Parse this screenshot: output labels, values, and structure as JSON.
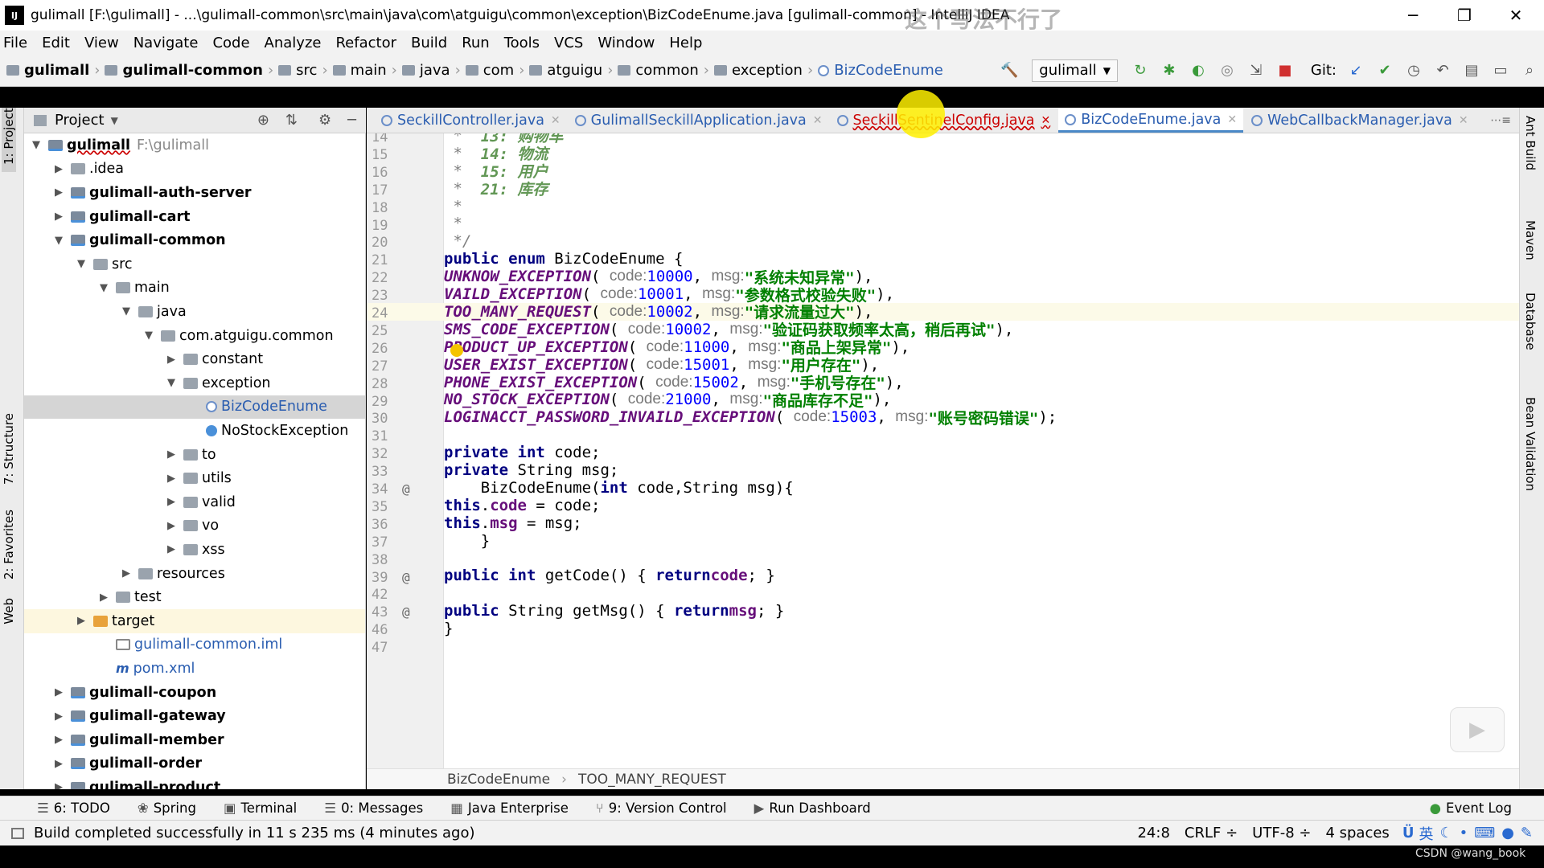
{
  "window": {
    "title": "gulimall [F:\\gulimall] - ...\\gulimall-common\\src\\main\\java\\com\\atguigu\\common\\exception\\BizCodeEnume.java [gulimall-common] - IntelliJ IDEA",
    "overlay_text": "这个写法不行了"
  },
  "menu": [
    "File",
    "Edit",
    "View",
    "Navigate",
    "Code",
    "Analyze",
    "Refactor",
    "Build",
    "Run",
    "Tools",
    "VCS",
    "Window",
    "Help"
  ],
  "breadcrumbs": [
    "gulimall",
    "gulimall-common",
    "src",
    "main",
    "java",
    "com",
    "atguigu",
    "common",
    "exception",
    "BizCodeEnume"
  ],
  "toolbar": {
    "run_config": "gulimall",
    "git_label": "Git:"
  },
  "left_tabs": [
    "1: Project",
    "7: Structure",
    "2: Favorites",
    "Web"
  ],
  "project": {
    "header": "Project",
    "root_name": "gulimall",
    "root_path": "F:\\gulimall",
    "tree": [
      {
        "label": ".idea",
        "indent": 1,
        "arrow": "right",
        "icon": "fold"
      },
      {
        "label": "gulimall-auth-server",
        "indent": 1,
        "arrow": "right",
        "icon": "mod",
        "bold": true
      },
      {
        "label": "gulimall-cart",
        "indent": 1,
        "arrow": "right",
        "icon": "mod",
        "bold": true
      },
      {
        "label": "gulimall-common",
        "indent": 1,
        "arrow": "down",
        "icon": "mod",
        "bold": true
      },
      {
        "label": "src",
        "indent": 2,
        "arrow": "down",
        "icon": "fold"
      },
      {
        "label": "main",
        "indent": 3,
        "arrow": "down",
        "icon": "fold"
      },
      {
        "label": "java",
        "indent": 4,
        "arrow": "down",
        "icon": "fold"
      },
      {
        "label": "com.atguigu.common",
        "indent": 5,
        "arrow": "down",
        "icon": "fold"
      },
      {
        "label": "constant",
        "indent": 6,
        "arrow": "right",
        "icon": "fold"
      },
      {
        "label": "exception",
        "indent": 6,
        "arrow": "down",
        "icon": "fold"
      },
      {
        "label": "BizCodeEnume",
        "indent": 7,
        "arrow": "",
        "icon": "enum",
        "selected": true,
        "blue": true
      },
      {
        "label": "NoStockException",
        "indent": 7,
        "arrow": "",
        "icon": "exc"
      },
      {
        "label": "to",
        "indent": 6,
        "arrow": "right",
        "icon": "fold"
      },
      {
        "label": "utils",
        "indent": 6,
        "arrow": "right",
        "icon": "fold"
      },
      {
        "label": "valid",
        "indent": 6,
        "arrow": "right",
        "icon": "fold"
      },
      {
        "label": "vo",
        "indent": 6,
        "arrow": "right",
        "icon": "fold"
      },
      {
        "label": "xss",
        "indent": 6,
        "arrow": "right",
        "icon": "fold"
      },
      {
        "label": "resources",
        "indent": 4,
        "arrow": "right",
        "icon": "fold"
      },
      {
        "label": "test",
        "indent": 3,
        "arrow": "right",
        "icon": "fold"
      },
      {
        "label": "target",
        "indent": 2,
        "arrow": "right",
        "icon": "org",
        "hl": true
      },
      {
        "label": "gulimall-common.iml",
        "indent": 3,
        "arrow": "",
        "icon": "iml",
        "blue": true
      },
      {
        "label": "pom.xml",
        "indent": 3,
        "arrow": "",
        "icon": "pom",
        "blue": true
      },
      {
        "label": "gulimall-coupon",
        "indent": 1,
        "arrow": "right",
        "icon": "mod",
        "bold": true
      },
      {
        "label": "gulimall-gateway",
        "indent": 1,
        "arrow": "right",
        "icon": "mod",
        "bold": true
      },
      {
        "label": "gulimall-member",
        "indent": 1,
        "arrow": "right",
        "icon": "mod",
        "bold": true
      },
      {
        "label": "gulimall-order",
        "indent": 1,
        "arrow": "right",
        "icon": "mod",
        "bold": true
      },
      {
        "label": "gulimall-product",
        "indent": 1,
        "arrow": "right",
        "icon": "mod",
        "bold": true
      }
    ]
  },
  "tabs": [
    {
      "label": "SeckillController.java"
    },
    {
      "label": "GulimallSeckillApplication.java"
    },
    {
      "label": "SeckillSentinelConfig.java",
      "error": true
    },
    {
      "label": "BizCodeEnume.java",
      "active": true
    },
    {
      "label": "WebCallbackManager.java"
    }
  ],
  "code_lines": [
    {
      "n": "14",
      "html": "<span class='cm'> *  </span><span class='cmz'>13: 购物车</span>"
    },
    {
      "n": "15",
      "html": "<span class='cm'> *  </span><span class='cmz'>14: 物流</span>"
    },
    {
      "n": "16",
      "html": "<span class='cm'> *  </span><span class='cmz'>15: 用户</span>"
    },
    {
      "n": "17",
      "html": "<span class='cm'> *  </span><span class='cmz'>21: 库存</span>"
    },
    {
      "n": "18",
      "html": "<span class='cm'> *</span>"
    },
    {
      "n": "19",
      "html": "<span class='cm'> *</span>"
    },
    {
      "n": "20",
      "html": "<span class='cm'> */</span>"
    },
    {
      "n": "21",
      "html": "<span class='kw'>public enum</span> BizCodeEnume {"
    },
    {
      "n": "22",
      "html": "    <span class='en'>UNKNOW_EXCEPTION</span>( <span class='hint'>code:</span> <span class='num'>10000</span>, <span class='hint'>msg:</span> <span class='str'>\"系统未知异常\"</span>),"
    },
    {
      "n": "23",
      "html": "    <span class='en'>VAILD_EXCEPTION</span>( <span class='hint'>code:</span> <span class='num'>10001</span>, <span class='hint'>msg:</span> <span class='str'>\"参数格式校验失败\"</span>),"
    },
    {
      "n": "24",
      "html": "    <span class='en'>TOO_MANY_REQUEST</span>( <span class='hint'>code:</span> <span class='num'>10002</span>, <span class='hint'>msg:</span> <span class='str'>\"请求流量过大\"</span>),",
      "current": true
    },
    {
      "n": "25",
      "html": "    <span class='en'>SMS_CODE_EXCEPTION</span>( <span class='hint'>code:</span> <span class='num'>10002</span>, <span class='hint'>msg:</span> <span class='str'>\"验证码获取频率太高，稍后再试\"</span>),"
    },
    {
      "n": "26",
      "html": "    <span class='en'>PRODUCT_UP_EXCEPTION</span>( <span class='hint'>code:</span> <span class='num'>11000</span>, <span class='hint'>msg:</span> <span class='str'>\"商品上架异常\"</span>),"
    },
    {
      "n": "27",
      "html": "    <span class='en'>USER_EXIST_EXCEPTION</span>( <span class='hint'>code:</span> <span class='num'>15001</span>, <span class='hint'>msg:</span> <span class='str'>\"用户存在\"</span>),"
    },
    {
      "n": "28",
      "html": "    <span class='en'>PHONE_EXIST_EXCEPTION</span>( <span class='hint'>code:</span> <span class='num'>15002</span>, <span class='hint'>msg:</span> <span class='str'>\"手机号存在\"</span>),"
    },
    {
      "n": "29",
      "html": "    <span class='en'>NO_STOCK_EXCEPTION</span>( <span class='hint'>code:</span> <span class='num'>21000</span>, <span class='hint'>msg:</span> <span class='str'>\"商品库存不足\"</span>),"
    },
    {
      "n": "30",
      "html": "    <span class='en'>LOGINACCT_PASSWORD_INVAILD_EXCEPTION</span>( <span class='hint'>code:</span> <span class='num'>15003</span>, <span class='hint'>msg:</span> <span class='str'>\"账号密码错误\"</span>);"
    },
    {
      "n": "31",
      "html": ""
    },
    {
      "n": "32",
      "html": "    <span class='kw'>private int</span> code;"
    },
    {
      "n": "33",
      "html": "    <span class='kw'>private</span> String msg;"
    },
    {
      "n": "34",
      "html": "    BizCodeEnume(<span class='kw'>int</span> code,String msg){",
      "mark": "@"
    },
    {
      "n": "35",
      "html": "        <span class='kw'>this</span>.<span class='fld'>code</span> = code;"
    },
    {
      "n": "36",
      "html": "        <span class='kw'>this</span>.<span class='fld'>msg</span> = msg;"
    },
    {
      "n": "37",
      "html": "    }"
    },
    {
      "n": "38",
      "html": ""
    },
    {
      "n": "39",
      "html": "    <span class='kw'>public int</span> getCode() { <span class='kw'>return</span> <span class='fld'>code</span>; }",
      "mark": "@"
    },
    {
      "n": "42",
      "html": ""
    },
    {
      "n": "43",
      "html": "    <span class='kw'>public</span> String getMsg() { <span class='kw'>return</span> <span class='fld'>msg</span>; }",
      "mark": "@"
    },
    {
      "n": "46",
      "html": "}"
    },
    {
      "n": "47",
      "html": ""
    }
  ],
  "editor_breadcrumb": [
    "BizCodeEnume",
    "TOO_MANY_REQUEST"
  ],
  "right_tabs": [
    "Ant Build",
    "Maven",
    "Database",
    "Bean Validation"
  ],
  "bottom_tabs": [
    {
      "icon": "☰",
      "label": "6: TODO"
    },
    {
      "icon": "❀",
      "label": "Spring"
    },
    {
      "icon": "▣",
      "label": "Terminal"
    },
    {
      "icon": "☰",
      "label": "0: Messages"
    },
    {
      "icon": "▦",
      "label": "Java Enterprise"
    },
    {
      "icon": "⑂",
      "label": "9: Version Control"
    },
    {
      "icon": "▶",
      "label": "Run Dashboard"
    }
  ],
  "event_log": "Event Log",
  "status": {
    "message": "Build completed successfully in 11 s 235 ms (4 minutes ago)",
    "position": "24:8",
    "line_sep": "CRLF ÷",
    "encoding": "UTF-8 ÷",
    "indent": "4 spaces",
    "ime": "英",
    "watermark": "CSDN @wang_book"
  }
}
